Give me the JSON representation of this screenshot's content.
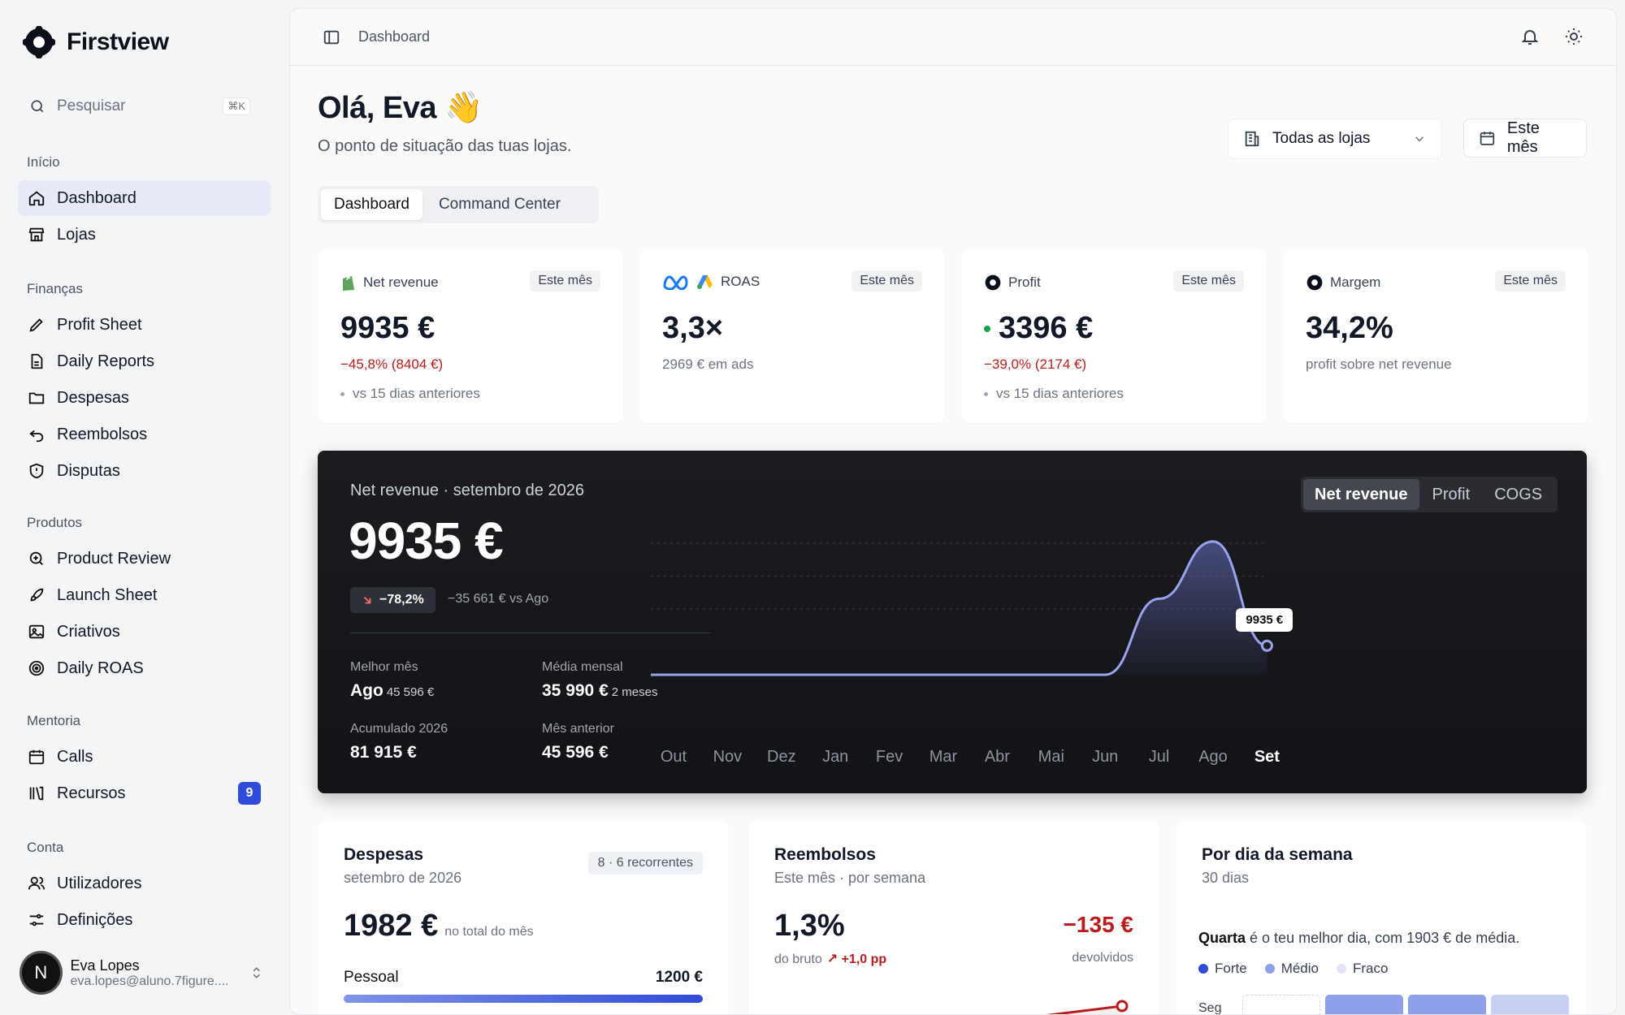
{
  "brand": {
    "name": "Firstview"
  },
  "search": {
    "placeholder": "Pesquisar",
    "shortcut": "⌘K"
  },
  "sidebar": {
    "sections": [
      {
        "title": "Início",
        "items": [
          {
            "label": "Dashboard",
            "icon": "home-icon",
            "active": true
          },
          {
            "label": "Lojas",
            "icon": "store-icon"
          }
        ]
      },
      {
        "title": "Finanças",
        "items": [
          {
            "label": "Profit Sheet",
            "icon": "pencil-icon"
          },
          {
            "label": "Daily Reports",
            "icon": "file-icon"
          },
          {
            "label": "Despesas",
            "icon": "folder-icon"
          },
          {
            "label": "Reembolsos",
            "icon": "undo-icon"
          },
          {
            "label": "Disputas",
            "icon": "shield-icon"
          }
        ]
      },
      {
        "title": "Produtos",
        "items": [
          {
            "label": "Product Review",
            "icon": "search-zoom-icon"
          },
          {
            "label": "Launch Sheet",
            "icon": "rocket-icon"
          },
          {
            "label": "Criativos",
            "icon": "image-icon"
          },
          {
            "label": "Daily ROAS",
            "icon": "target-icon"
          }
        ]
      },
      {
        "title": "Mentoria",
        "items": [
          {
            "label": "Calls",
            "icon": "calendar-icon"
          },
          {
            "label": "Recursos",
            "icon": "library-icon",
            "badge": "9"
          }
        ]
      },
      {
        "title": "Conta",
        "items": [
          {
            "label": "Utilizadores",
            "icon": "users-icon"
          },
          {
            "label": "Definições",
            "icon": "sliders-icon"
          }
        ]
      }
    ]
  },
  "user": {
    "initial": "N",
    "name": "Eva Lopes",
    "email": "eva.lopes@aluno.7figure...."
  },
  "topbar": {
    "breadcrumb": "Dashboard"
  },
  "header": {
    "greeting": "Olá, Eva 👋",
    "subtitle": "O ponto de situação das tuas lojas.",
    "store_select": "Todas as lojas",
    "period_button": "Este mês"
  },
  "tabs": [
    {
      "label": "Dashboard",
      "active": true
    },
    {
      "label": "Command Center"
    }
  ],
  "kpis": [
    {
      "label": "Net revenue",
      "tag": "Este mês",
      "value": "9935 €",
      "delta": "−45,8% (8404 €)",
      "note": "vs 15 dias anteriores"
    },
    {
      "label": "ROAS",
      "tag": "Este mês",
      "value": "3,3×",
      "sub": "2969 € em ads"
    },
    {
      "label": "Profit",
      "tag": "Este mês",
      "value": "3396 €",
      "delta": "−39,0% (2174 €)",
      "note": "vs 15 dias anteriores"
    },
    {
      "label": "Margem",
      "tag": "Este mês",
      "value": "34,2%",
      "sub": "profit sobre net revenue"
    }
  ],
  "revenue_panel": {
    "title": "Net revenue · setembro de 2026",
    "value": "9935 €",
    "delta": "−78,2%",
    "delta_vs": "−35 661 € vs Ago",
    "stats": [
      {
        "label": "Melhor mês",
        "value": "Ago",
        "extra": "45 596 €"
      },
      {
        "label": "Média mensal",
        "value": "35 990 €",
        "extra": "2 meses"
      },
      {
        "label": "Acumulado 2026",
        "value": "81 915 €"
      },
      {
        "label": "Mês anterior",
        "value": "45 596 €"
      }
    ],
    "toggle": [
      {
        "label": "Net revenue",
        "active": true
      },
      {
        "label": "Profit"
      },
      {
        "label": "COGS"
      }
    ],
    "tooltip": "9935 €"
  },
  "chart_data": {
    "type": "area",
    "categories": [
      "Out",
      "Nov",
      "Dez",
      "Jan",
      "Fev",
      "Mar",
      "Abr",
      "Mai",
      "Jun",
      "Jul",
      "Ago",
      "Set"
    ],
    "values": [
      0,
      0,
      0,
      0,
      0,
      0,
      0,
      0,
      0,
      26000,
      45596,
      9935
    ],
    "ylim": [
      0,
      50000
    ],
    "highlight_category": "Set",
    "title": "Net revenue · setembro de 2026",
    "grid": true
  },
  "despesas": {
    "title": "Despesas",
    "subtitle": "setembro de 2026",
    "tag": "8 · 6 recorrentes",
    "value": "1982 €",
    "value_note": "no total do mês",
    "row_label": "Pessoal",
    "row_value": "1200 €",
    "row_fraction": 1.0
  },
  "reembolsos": {
    "title": "Reembolsos",
    "subtitle": "Este mês · por semana",
    "pct": "1,3%",
    "pct_note": "do bruto",
    "pct_delta": "↗ +1,0 pp",
    "amount": "−135 €",
    "amount_note": "devolvidos"
  },
  "weekday": {
    "title": "Por dia da semana",
    "subtitle": "30 dias",
    "best_day": "Quarta",
    "best_text": " é o teu melhor dia, com 1903 € de média.",
    "legend": [
      {
        "label": "Forte",
        "color": "#2f4bd9"
      },
      {
        "label": "Médio",
        "color": "#8ea0ea"
      },
      {
        "label": "Fraco",
        "color": "#dfe4f7"
      }
    ],
    "first_row": "Seg"
  },
  "colors": {
    "accent": "#2f4bd9",
    "negative": "#b91c1c",
    "positive": "#16a34a"
  }
}
